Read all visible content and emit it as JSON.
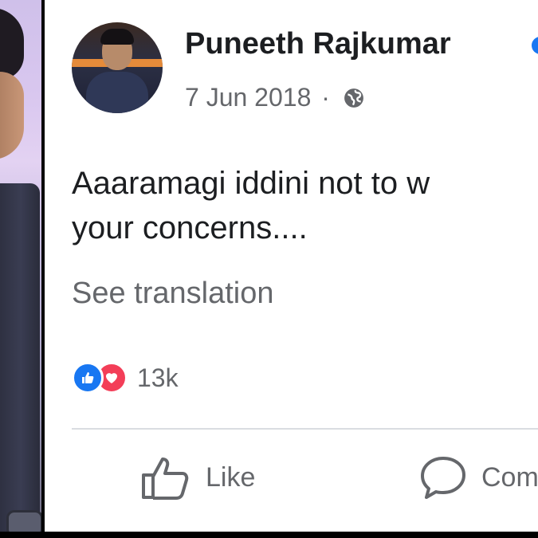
{
  "post": {
    "author": "Puneeth Rajkumar",
    "date": "7 Jun 2018",
    "separator": "·",
    "privacy_icon": "globe-icon",
    "text_lines": [
      "Aaaramagi iddini not to w",
      "your concerns...."
    ],
    "see_translation": "See translation",
    "reaction_count": "13k",
    "reactions": [
      "like-icon",
      "love-icon"
    ]
  },
  "actions": {
    "like_label": "Like",
    "comment_label": "Com"
  },
  "colors": {
    "accent": "#1877f2",
    "love": "#f33e58",
    "secondary_text": "#65676b",
    "primary_text": "#1c1e21"
  }
}
